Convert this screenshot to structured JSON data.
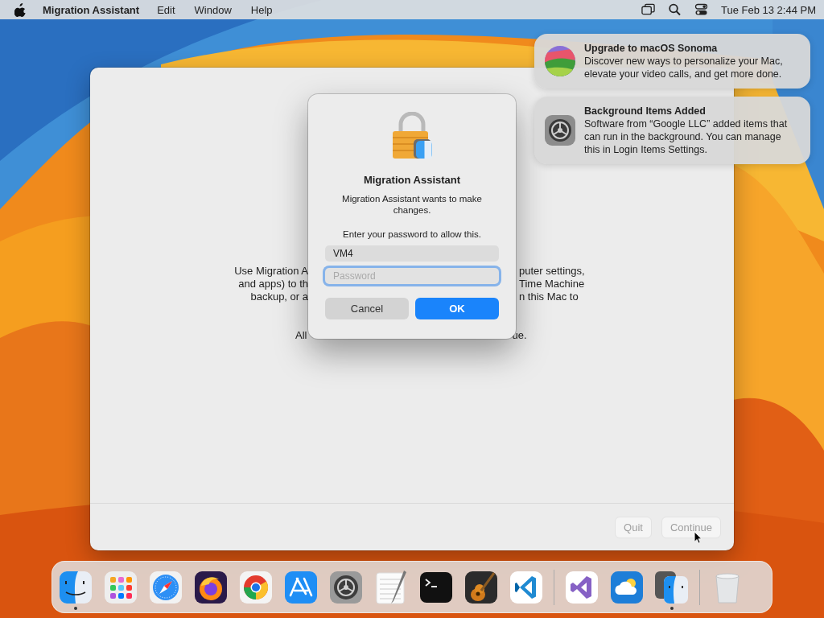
{
  "menu_bar": {
    "app_name": "Migration Assistant",
    "menus": [
      "Edit",
      "Window",
      "Help"
    ],
    "clock": "Tue Feb 13  2:44 PM"
  },
  "notifications": [
    {
      "kind": "sonoma",
      "title": "Upgrade to macOS Sonoma",
      "body": "Discover new ways to personalize your Mac, elevate your video calls, and get more done."
    },
    {
      "kind": "settings",
      "title": "Background Items Added",
      "body": "Software from “Google LLC” added items that can run in the background. You can manage this in Login Items Settings."
    }
  ],
  "window": {
    "text_left": [
      "Use Migration A",
      "and apps) to th",
      "backup, or a"
    ],
    "text_right": [
      "puter settings,",
      "Time Machine",
      "n this Mac to"
    ],
    "footer_left": "All",
    "footer_right": "ue.",
    "buttons": [
      {
        "label": "Quit",
        "disabled": true
      },
      {
        "label": "Continue",
        "disabled": true
      }
    ]
  },
  "dialog": {
    "title": "Migration Assistant",
    "message": "Migration Assistant wants to make changes.",
    "prompt": "Enter your password to allow this.",
    "username": "VM4",
    "password": {
      "placeholder": "Password",
      "focused": true
    },
    "buttons": [
      {
        "label": "Cancel",
        "default": false
      },
      {
        "label": "OK",
        "default": true
      }
    ]
  },
  "dock": {
    "groups": [
      [
        {
          "kind": "finder",
          "running": true
        },
        {
          "kind": "launchpad",
          "running": false
        },
        {
          "kind": "safari",
          "running": false
        },
        {
          "kind": "firefox",
          "running": false
        },
        {
          "kind": "chrome",
          "running": false
        },
        {
          "kind": "appstore",
          "running": false
        },
        {
          "kind": "settings",
          "running": false
        },
        {
          "kind": "textedit",
          "running": false
        },
        {
          "kind": "terminal",
          "running": false
        },
        {
          "kind": "garageband",
          "running": false
        },
        {
          "kind": "vscode",
          "running": false
        }
      ],
      [
        {
          "kind": "visualstudio",
          "running": false
        },
        {
          "kind": "weather",
          "running": false
        },
        {
          "kind": "migration",
          "running": true
        }
      ],
      [
        {
          "kind": "trash",
          "running": false
        }
      ]
    ]
  }
}
